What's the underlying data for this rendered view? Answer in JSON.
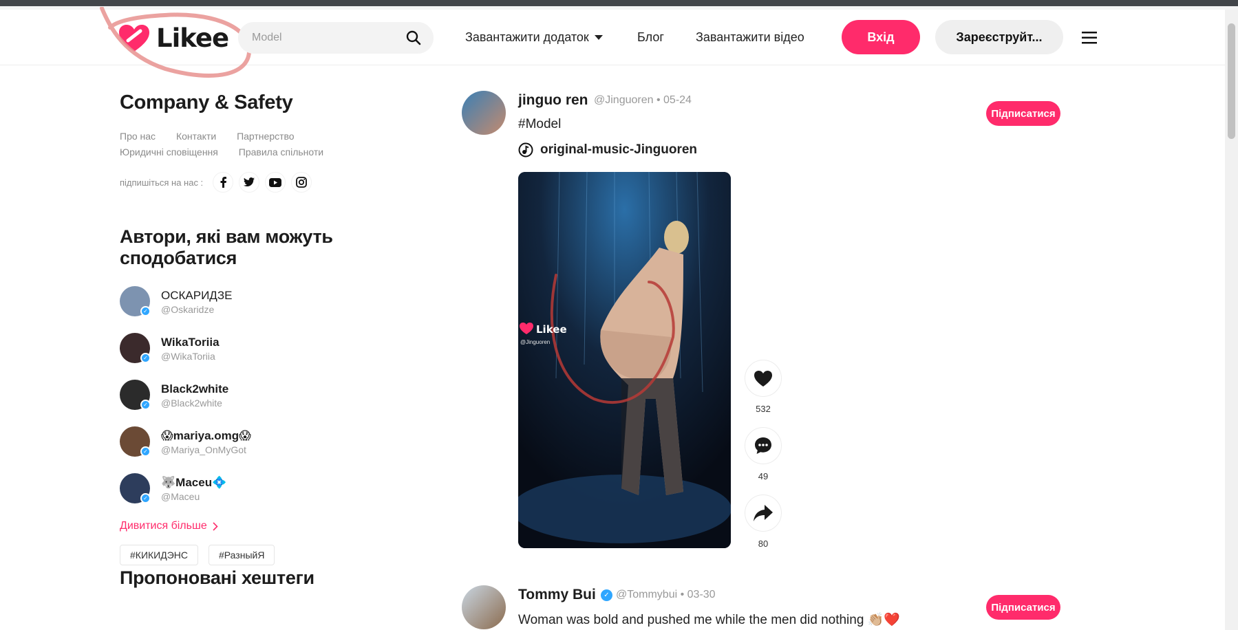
{
  "header": {
    "logo_text": "Likee",
    "search_placeholder": "Model",
    "nav": {
      "download_app": "Завантажити додаток",
      "blog": "Блог",
      "upload_video": "Завантажити відео"
    },
    "login_label": "Вхід",
    "register_label": "Зареєструйт..."
  },
  "sidebar": {
    "company_title": "Company & Safety",
    "links_row1": [
      "Про нас",
      "Контакти",
      "Партнерство"
    ],
    "links_row2": [
      "Юридичні сповіщення",
      "Правила спільноти"
    ],
    "follow_label": "підпишіться на нас :",
    "socials": [
      "facebook-icon",
      "twitter-icon",
      "youtube-icon",
      "instagram-icon"
    ],
    "creators_title": "Автори, які вам можуть сподобатися",
    "creators": [
      {
        "name": "ОСКАРИДЗЕ",
        "handle": "@Oskaridze",
        "color": "#7d93b0"
      },
      {
        "name": "WikaToriia",
        "handle": "@WikaToriia",
        "color": "#3b2a2c"
      },
      {
        "name": "Black2white",
        "handle": "@Black2white",
        "color": "#2b2b2b"
      },
      {
        "name": "😱mariya.omg😱",
        "handle": "@Mariya_OnMyGot",
        "color": "#6b4a35"
      },
      {
        "name": "🐺Maceu💠",
        "handle": "@Maceu",
        "color": "#2d3d5c"
      }
    ],
    "see_more": "Дивитися більше",
    "hashtags_title": "Пропоновані хештеги",
    "hashtags": [
      "#КИКИДЭНС",
      "#РазныйЯ"
    ]
  },
  "posts": [
    {
      "name": "jinguo ren",
      "handle": "@Jinguoren",
      "date": "05-24",
      "caption": "#Model",
      "music": "original-music-Jinguoren",
      "follow_label": "Підписатися",
      "likes": "532",
      "comments": "49",
      "shares": "80",
      "watermark": "Likee",
      "watermark_handle": "@Jinguoren"
    },
    {
      "name": "Tommy Bui",
      "handle": "@Tommybui",
      "date": "03-30",
      "caption": "Woman was bold and pushed me while the men did nothing 👏🏼❤️",
      "follow_label": "Підписатися"
    }
  ],
  "colors": {
    "brand_pink": "#ff2b6b",
    "annotation_red": "#c0392b"
  }
}
